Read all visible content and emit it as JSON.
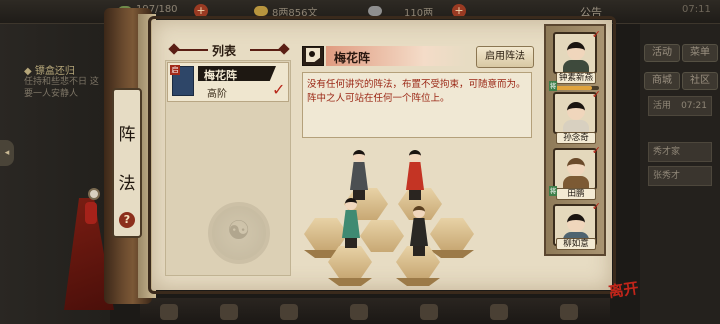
{
  "top_bar": {
    "stamina": "197/180",
    "coins": "8两856文",
    "silver": "110两",
    "notice": "公告",
    "time": "07:11"
  },
  "left_bg": {
    "quest_title": "◆ 镖盒还归",
    "quest_text": "任持和些悲不日 这要一人安静人"
  },
  "right_bg": {
    "buttons": [
      "活动",
      "菜单",
      "商城",
      "社区"
    ],
    "bar1": "活用",
    "bar1_time": "07:21",
    "entries": [
      "秀才家",
      "张秀才"
    ]
  },
  "scroll_tab": {
    "chars": [
      "阵",
      "法"
    ],
    "help": "?"
  },
  "list_panel": {
    "title": "列表",
    "items": [
      {
        "stamp": "启",
        "name": "梅花阵",
        "grade": "高阶",
        "selected": true
      }
    ]
  },
  "formation": {
    "name": "梅花阵",
    "enable_label": "启用阵法",
    "description": "没有任何讲究的阵法，布置不受拘束，可随意而为。阵中之人可站在任何一个阵位上。"
  },
  "roster": [
    {
      "name": "钟素新燕",
      "cloth": "#3e4a3c",
      "level": 0.85
    },
    {
      "name": "孙念奇",
      "cloth": "#d8d0c0",
      "level": 0.6
    },
    {
      "name": "田鹏",
      "cloth": "#7c5a34",
      "level": 0.7
    },
    {
      "name": "柳如意",
      "cloth": "#4f6470",
      "level": 0.5
    }
  ],
  "leave_label": "离开",
  "colors": {
    "accent_red": "#b8281a",
    "paper": "#e7dcc3",
    "desc_text": "#9a2614"
  }
}
